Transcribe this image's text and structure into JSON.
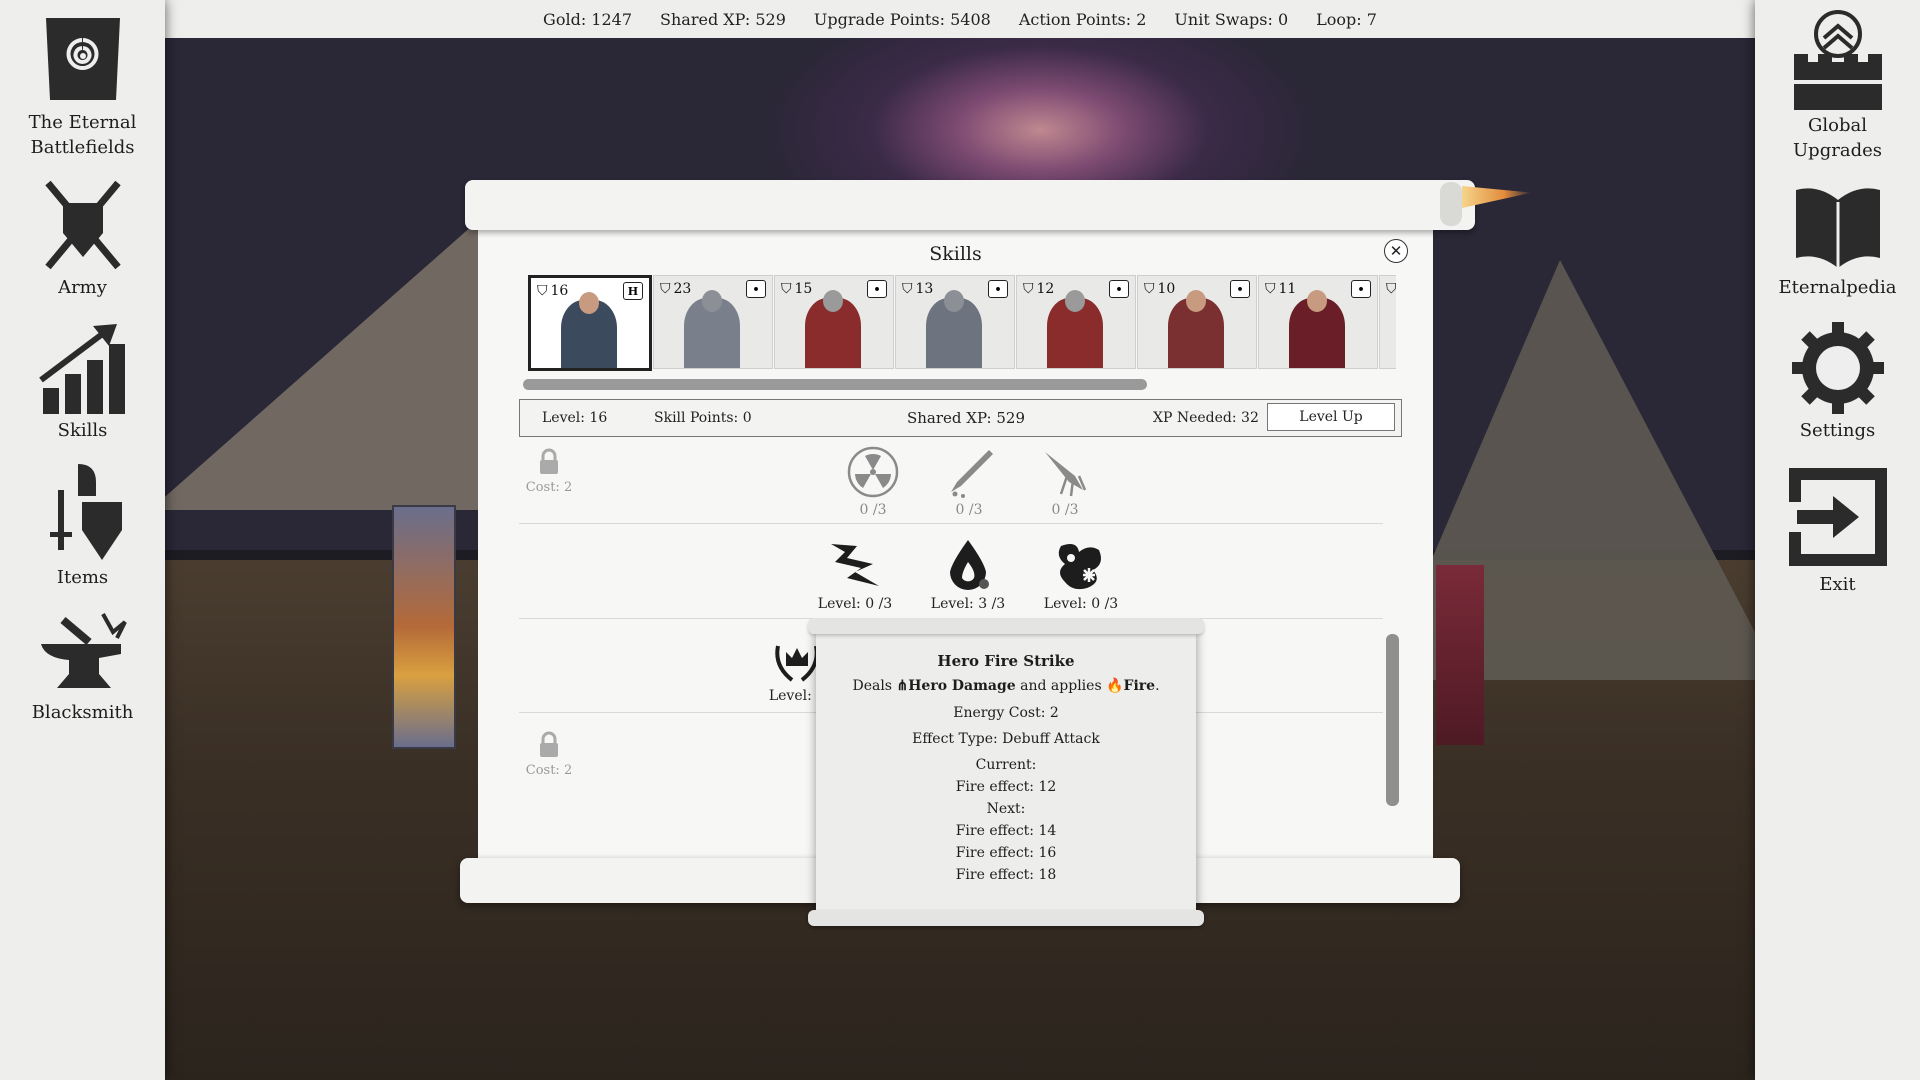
{
  "topbar": {
    "gold": "Gold: 1247",
    "shared_xp": "Shared XP: 529",
    "upgrade_points": "Upgrade Points: 5408",
    "action_points": "Action Points: 2",
    "unit_swaps": "Unit Swaps: 0",
    "loop": "Loop: 7"
  },
  "left_nav": {
    "eternal_line1": "The Eternal",
    "eternal_line2": "Battlefields",
    "army": "Army",
    "skills": "Skills",
    "items": "Items",
    "blacksmith": "Blacksmith"
  },
  "right_nav": {
    "global_line1": "Global",
    "global_line2": "Upgrades",
    "eternalpedia": "Eternalpedia",
    "settings": "Settings",
    "exit": "Exit"
  },
  "window": {
    "title": "Skills",
    "close_icon": "close-icon"
  },
  "units": [
    {
      "level": "16",
      "tag": "H",
      "color": "#3c4a5e"
    },
    {
      "level": "23",
      "tag": "",
      "color": "#7a7f8c"
    },
    {
      "level": "15",
      "tag": "",
      "color": "#8a2c2c"
    },
    {
      "level": "13",
      "tag": "",
      "color": "#6e7380"
    },
    {
      "level": "12",
      "tag": "",
      "color": "#8a2c2c"
    },
    {
      "level": "10",
      "tag": "",
      "color": "#7a3030"
    },
    {
      "level": "11",
      "tag": "",
      "color": "#6a1e28"
    }
  ],
  "stats": {
    "level": "Level: 16",
    "skill_points": "Skill Points: 0",
    "shared_xp": "Shared XP: 529",
    "xp_needed": "XP Needed: 32",
    "level_up": "Level Up"
  },
  "skill_rows": {
    "row1_cost": "Cost: 2",
    "row1_skills": [
      "0 /3",
      "0 /3",
      "0 /3"
    ],
    "row2_skills": [
      "Level: 0 /3",
      "Level: 3 /3",
      "Level: 0 /3"
    ],
    "row3_skill": "Level: 0",
    "row4_cost": "Cost: 2"
  },
  "tooltip": {
    "title": "Hero Fire Strike",
    "deals": "Deals",
    "hero_damage": "Hero Damage",
    "and_applies": "and applies",
    "fire": "Fire",
    "period": ".",
    "energy_cost": "Energy Cost: 2",
    "effect_type": "Effect Type: Debuff Attack",
    "current_label": "Current:",
    "current_value": "Fire effect: 12",
    "next_label": "Next:",
    "next_values": [
      "Fire effect: 14",
      "Fire effect: 16",
      "Fire effect: 18"
    ]
  }
}
